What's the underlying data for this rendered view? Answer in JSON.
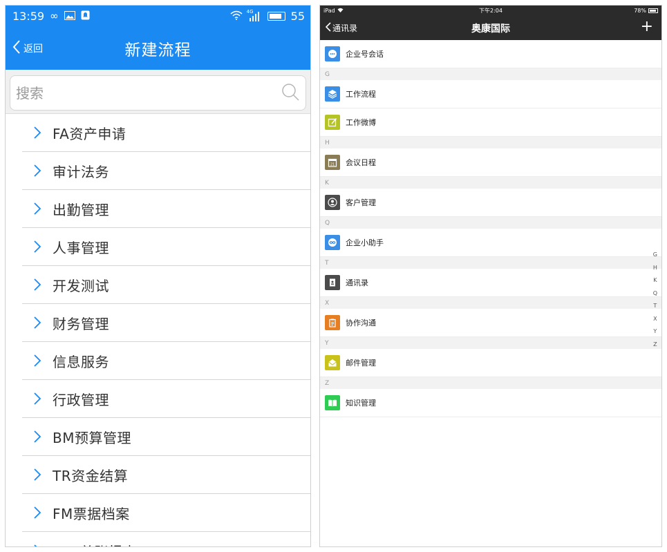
{
  "left": {
    "status": {
      "time": "13:59",
      "network": "4G",
      "battery": "55"
    },
    "nav": {
      "back_label": "返回",
      "title": "新建流程"
    },
    "search": {
      "placeholder": "搜索",
      "value": ""
    },
    "items": [
      {
        "label": "FA资产申请"
      },
      {
        "label": "审计法务"
      },
      {
        "label": "出勤管理"
      },
      {
        "label": "人事管理"
      },
      {
        "label": "开发测试"
      },
      {
        "label": "财务管理"
      },
      {
        "label": "信息服务"
      },
      {
        "label": "行政管理"
      },
      {
        "label": "BM预算管理"
      },
      {
        "label": "TR资金结算"
      },
      {
        "label": "FM票据档案"
      },
      {
        "label": "RTR总账报表"
      }
    ],
    "accent": "#1a8af2"
  },
  "right": {
    "status": {
      "device": "iPad",
      "time": "下午2:04",
      "battery": "78%"
    },
    "nav": {
      "back_label": "通讯录",
      "title": "奥康国际",
      "plus": "+"
    },
    "top_item": {
      "label": "企业号会话",
      "icon": "chat-bubble-icon",
      "color": "#3a8ee6"
    },
    "sections": [
      {
        "letter": "G",
        "items": [
          {
            "label": "工作流程",
            "icon": "layers-icon",
            "color": "#3a8ee6"
          },
          {
            "label": "工作微博",
            "icon": "edit-icon",
            "color": "#b5c424"
          }
        ]
      },
      {
        "letter": "H",
        "items": [
          {
            "label": "会议日程",
            "icon": "calendar-icon",
            "color": "#8a7d55"
          }
        ]
      },
      {
        "letter": "K",
        "items": [
          {
            "label": "客户管理",
            "icon": "person-icon",
            "color": "#4b4b4b"
          }
        ]
      },
      {
        "letter": "Q",
        "items": [
          {
            "label": "企业小助手",
            "icon": "assistant-icon",
            "color": "#3a8ee6"
          }
        ]
      },
      {
        "letter": "T",
        "items": [
          {
            "label": "通讯录",
            "icon": "contacts-icon",
            "color": "#4b4b4b"
          }
        ]
      },
      {
        "letter": "X",
        "items": [
          {
            "label": "协作沟通",
            "icon": "clipboard-icon",
            "color": "#e67e22"
          }
        ]
      },
      {
        "letter": "Y",
        "items": [
          {
            "label": "邮件管理",
            "icon": "mail-icon",
            "color": "#c9c21a"
          }
        ]
      },
      {
        "letter": "Z",
        "items": [
          {
            "label": "知识管理",
            "icon": "book-icon",
            "color": "#2ecc52"
          }
        ]
      }
    ],
    "index_letters": [
      "G",
      "H",
      "K",
      "Q",
      "T",
      "X",
      "Y",
      "Z"
    ],
    "section_bg": "#f2f2f2"
  }
}
